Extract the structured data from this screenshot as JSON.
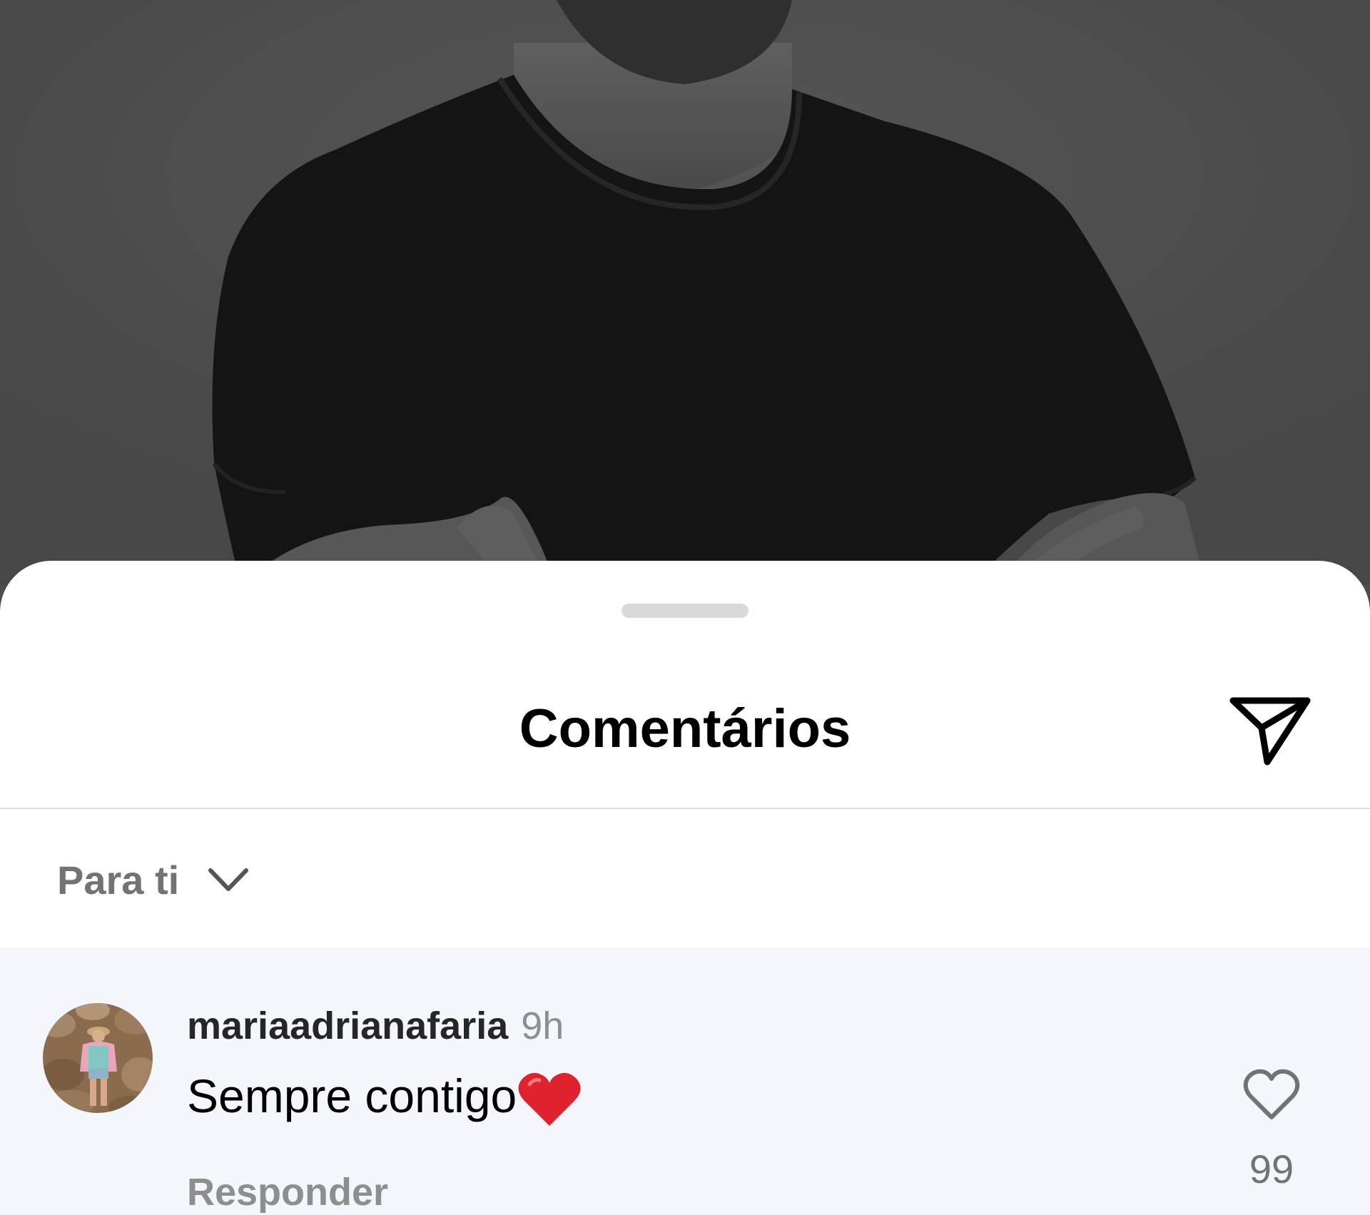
{
  "sheet": {
    "title": "Comentários",
    "share_icon": "send-icon"
  },
  "sort": {
    "selected": "Para ti",
    "icon": "chevron-down-icon"
  },
  "comments": [
    {
      "username": "mariaadrianafaria",
      "time": "9h",
      "text": "Sempre contigo",
      "emoji": "❤️",
      "reply_label": "Responder",
      "like_icon": "heart-outline-icon",
      "likes": "99"
    }
  ],
  "colors": {
    "sheet_background": "#ffffff",
    "comment_highlight": "#f3f7fb",
    "muted_text": "#8e8e8e",
    "divider": "#dbdbdb",
    "backdrop": "#4e4e4e"
  }
}
